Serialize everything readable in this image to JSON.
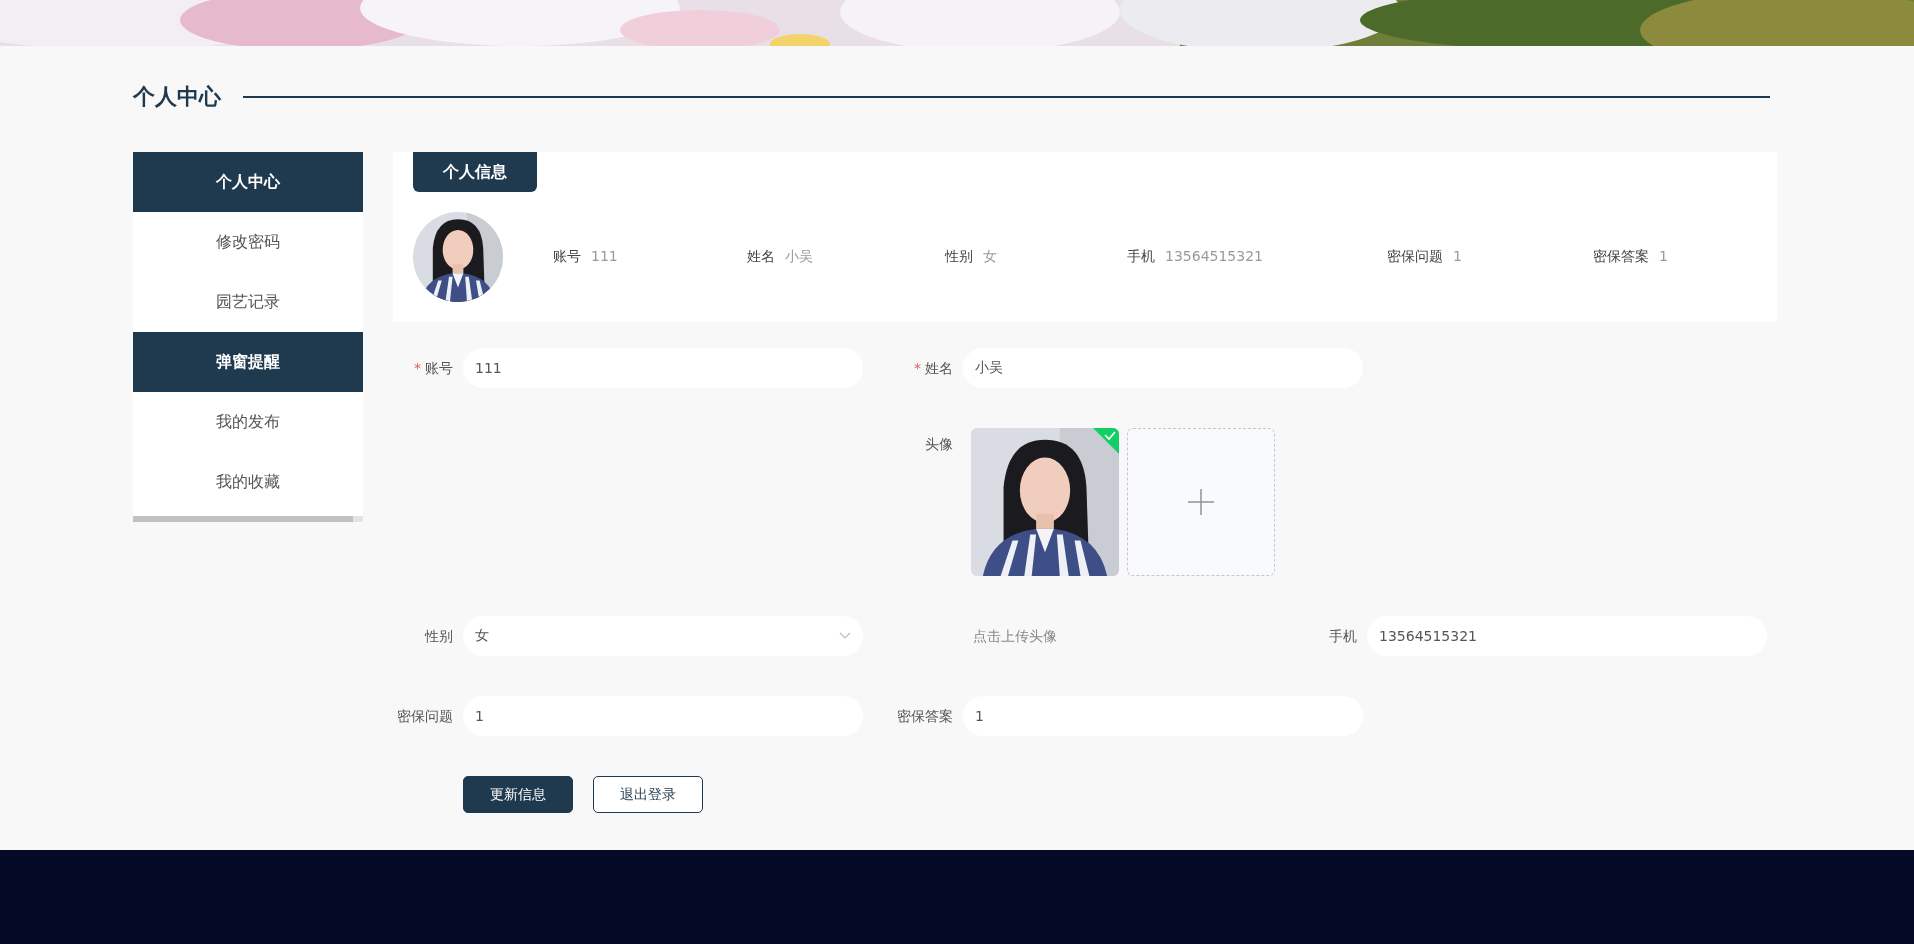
{
  "section_title": "个人中心",
  "sidebar": {
    "title": "个人中心",
    "items": [
      {
        "label": "修改密码",
        "selected": false
      },
      {
        "label": "园艺记录",
        "selected": false
      },
      {
        "label": "弹窗提醒",
        "selected": true
      },
      {
        "label": "我的发布",
        "selected": false
      },
      {
        "label": "我的收藏",
        "selected": false
      }
    ]
  },
  "profile_card": {
    "tab": "个人信息",
    "info": [
      {
        "label": "账号",
        "value": "111"
      },
      {
        "label": "姓名",
        "value": "小吴"
      },
      {
        "label": "性别",
        "value": "女"
      },
      {
        "label": "手机",
        "value": "13564515321"
      },
      {
        "label": "密保问题",
        "value": "1"
      },
      {
        "label": "密保答案",
        "value": "1"
      }
    ]
  },
  "form": {
    "rows": [
      [
        {
          "kind": "input",
          "label": "账号",
          "value": "111",
          "required_mark": "*"
        },
        {
          "kind": "input",
          "label": "姓名",
          "value": "小吴",
          "required_mark": "*"
        }
      ],
      [
        "",
        {
          "kind": "upload",
          "label": "头像"
        }
      ],
      [
        {
          "kind": "select",
          "label": "性别",
          "value": "女"
        },
        {
          "kind": "hint",
          "text": "点击上传头像"
        },
        {
          "kind": "input",
          "label": "手机",
          "value": "13564515321"
        }
      ],
      [
        {
          "kind": "input",
          "label": "密保问题",
          "value": "1"
        },
        {
          "kind": "input",
          "label": "密保答案",
          "value": "1"
        }
      ]
    ],
    "buttons": [
      {
        "label": "更新信息",
        "kind": "primary"
      },
      {
        "label": "退出登录",
        "kind": "outline"
      }
    ]
  }
}
